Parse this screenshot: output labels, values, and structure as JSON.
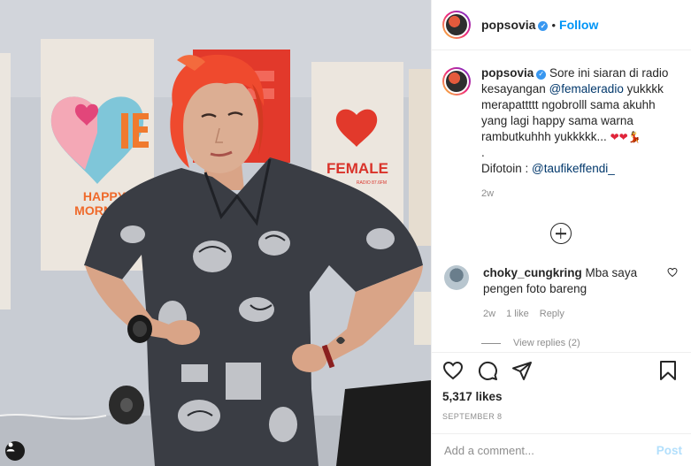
{
  "post_header": {
    "username": "popsovia",
    "separator": "•",
    "follow_label": "Follow"
  },
  "photo": {
    "sign_left_lines": [
      "HAPPY",
      "MORNING"
    ],
    "sign_center": "FEMALE",
    "sign_center_sub": "RADIO 87.6FM"
  },
  "caption": {
    "username": "popsovia",
    "text_1": "Sore ini siaran di radio kesayangan",
    "mention_1": "@femaleradio",
    "text_2": "yukkkk merapattttt ngobrolll sama akuhh yang lagi happy sama warna rambutkuhhh yukkkkk...",
    "line_dot": ".",
    "photo_credit_label": "Difotoin :",
    "mention_2": "@taufikeffendi_",
    "age": "2w"
  },
  "comment": {
    "username": "choky_cungkring",
    "text": "Mba saya pengen foto bareng",
    "age": "2w",
    "likes": "1 like",
    "reply_label": "Reply",
    "view_replies": "View replies (2)"
  },
  "stats": {
    "likes": "5,317 likes",
    "date": "SEPTEMBER 8"
  },
  "add_comment": {
    "placeholder": "Add a comment...",
    "post_label": "Post"
  },
  "icons": {
    "verified": "verified-badge-icon",
    "like": "heart-icon",
    "comment": "comment-bubble-icon",
    "share": "paper-plane-icon",
    "save": "bookmark-icon",
    "load_more": "plus-circle-icon",
    "comment_like": "small-heart-icon",
    "user_tag": "person-tag-icon"
  },
  "colors": {
    "follow_blue": "#0095f6",
    "mention_blue": "#00376b",
    "secondary_text": "#8e8e8e",
    "post_disabled": "#b2dffc",
    "verified_blue": "#3897f0"
  }
}
